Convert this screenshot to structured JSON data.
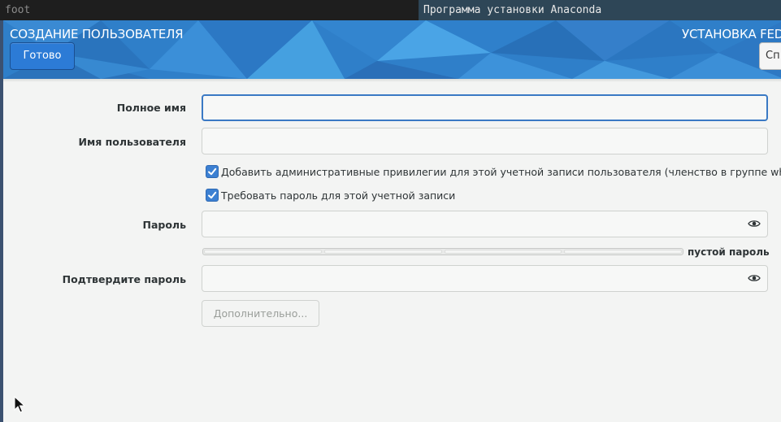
{
  "taskbar": {
    "items": [
      {
        "label": "foot"
      },
      {
        "label": "Программа установки Anaconda"
      }
    ]
  },
  "header": {
    "title": "СОЗДАНИЕ ПОЛЬЗОВАТЕЛЯ",
    "product": "УСТАНОВКА FED",
    "done_label": "Готово",
    "help_label": "Сп"
  },
  "form": {
    "full_name": {
      "label": "Полное имя",
      "value": ""
    },
    "username": {
      "label": "Имя пользователя",
      "value": ""
    },
    "admin_checkbox": {
      "label": "Добавить административные привилегии для этой учетной записи пользователя (членство в группе wheel)",
      "checked": true
    },
    "require_password_checkbox": {
      "label": "Требовать пароль для этой учетной записи",
      "checked": true
    },
    "password": {
      "label": "Пароль",
      "value": "",
      "icon": "eye-icon"
    },
    "strength": {
      "text": "пустой пароль",
      "level": 0
    },
    "confirm_password": {
      "label": "Подтвердите пароль",
      "value": "",
      "icon": "eye-icon"
    },
    "advanced_label": "Дополнительно..."
  },
  "colors": {
    "accent": "#3c80d2",
    "header_blue": "#2f7fc9",
    "focus_border": "#3a79c4"
  }
}
